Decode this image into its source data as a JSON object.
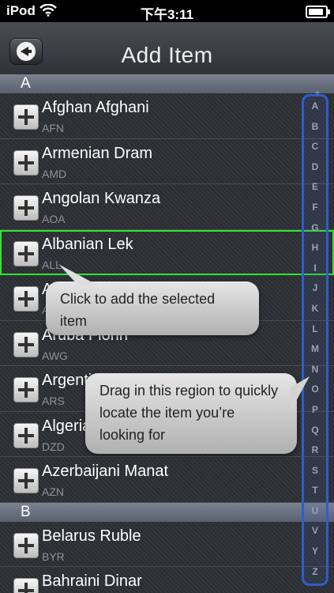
{
  "status_bar": {
    "carrier": "iPod",
    "time": "下午3:11",
    "battery_level": 0.9
  },
  "header": {
    "title": "Add Item"
  },
  "sections": [
    {
      "letter": "A",
      "items": [
        {
          "name": "Afghan Afghani",
          "code": "AFN"
        },
        {
          "name": "Armenian Dram",
          "code": "AMD"
        },
        {
          "name": "Angolan Kwanza",
          "code": "AOA"
        },
        {
          "name": "Albanian Lek",
          "code": "ALL",
          "selected": true
        },
        {
          "name": "Argentine Peso",
          "code": "ARS"
        },
        {
          "name": "Aruba Florin",
          "code": "AWG"
        },
        {
          "name": "Argentine Peso",
          "code": "ARS"
        },
        {
          "name": "Algerian Dinar",
          "code": "DZD"
        },
        {
          "name": "Azerbaijani Manat",
          "code": "AZN"
        }
      ]
    },
    {
      "letter": "B",
      "items": [
        {
          "name": "Belarus Ruble",
          "code": "BYR"
        },
        {
          "name": "Bahraini Dinar",
          "code": "BHD"
        }
      ]
    }
  ],
  "index_letters": [
    "A",
    "B",
    "C",
    "D",
    "E",
    "F",
    "G",
    "H",
    "I",
    "J",
    "K",
    "L",
    "M",
    "N",
    "O",
    "P",
    "Q",
    "R",
    "S",
    "T",
    "U",
    "V",
    "Y",
    "Z"
  ],
  "index_top_symbol": "+",
  "tooltips": {
    "add_hint": "Click to add the selected item",
    "index_hint": "Drag in this region to quickly locate the item you’re looking for"
  },
  "colors": {
    "selected_outline": "#32e632",
    "index_border": "#2d5dcc"
  }
}
